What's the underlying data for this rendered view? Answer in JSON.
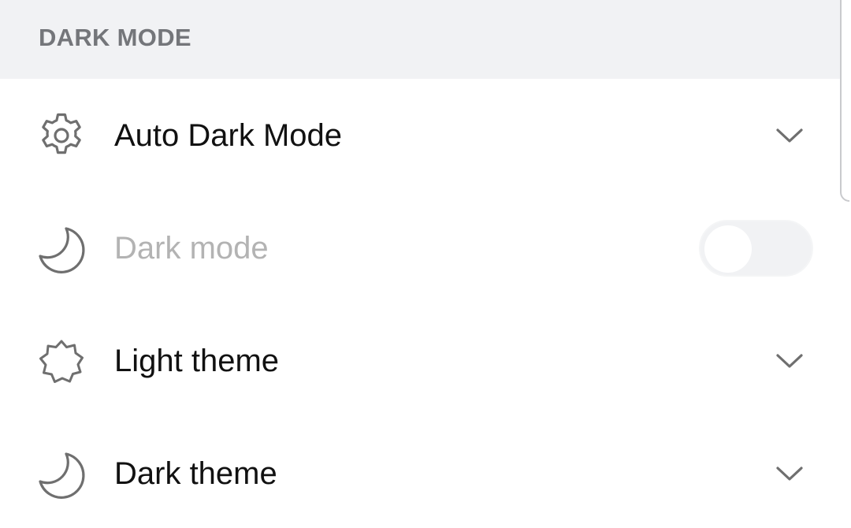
{
  "section": {
    "title": "DARK MODE"
  },
  "rows": [
    {
      "label": "Auto Dark Mode",
      "icon": "gear-icon",
      "control": "chevron-down-icon",
      "enabled": true
    },
    {
      "label": "Dark mode",
      "icon": "moon-icon",
      "control": "toggle",
      "enabled": false,
      "toggle_on": false
    },
    {
      "label": "Light theme",
      "icon": "sun-badge-icon",
      "control": "chevron-down-icon",
      "enabled": true
    },
    {
      "label": "Dark theme",
      "icon": "moon-icon",
      "control": "chevron-down-icon",
      "enabled": true
    }
  ],
  "colors": {
    "header_background": "#f1f2f4",
    "header_text": "#74767a",
    "label_text": "#111111",
    "disabled_text": "#b3b3b3",
    "icon_stroke": "#6f6f6f"
  }
}
